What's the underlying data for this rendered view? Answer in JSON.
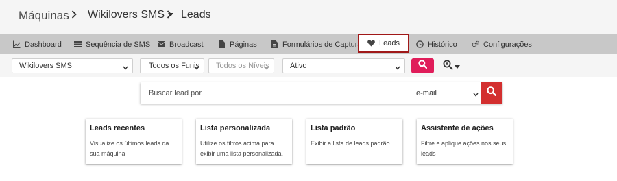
{
  "breadcrumb": {
    "root": "Máquinas",
    "machine": "Wikilovers SMS",
    "current": "Leads"
  },
  "tabs": [
    {
      "label": "Dashboard",
      "icon": "chart-line-icon"
    },
    {
      "label": "Sequência de SMS",
      "icon": "list-icon"
    },
    {
      "label": "Broadcast",
      "icon": "envelope-icon"
    },
    {
      "label": "Páginas",
      "icon": "file-icon"
    },
    {
      "label": "Formulários de Captura",
      "icon": "form-icon"
    },
    {
      "label": "Leads",
      "icon": "heart-icon",
      "active": true
    },
    {
      "label": "Histórico",
      "icon": "clock-icon"
    },
    {
      "label": "Configurações",
      "icon": "gears-icon"
    }
  ],
  "filters": {
    "machine": "Wikilovers SMS",
    "funnel": "Todos os Funis",
    "level": "Todos os Níveis",
    "status": "Ativo"
  },
  "search": {
    "placeholder": "Buscar lead por",
    "field": "e-mail"
  },
  "cards": [
    {
      "title": "Leads recentes",
      "description": "Visualize os últimos leads da sua máquina"
    },
    {
      "title": "Lista personalizada",
      "description": "Utilize os filtros acima para exibir uma lista personalizada."
    },
    {
      "title": "Lista padrão",
      "description": "Exibir a lista de leads padrão"
    },
    {
      "title": "Assistente de ações",
      "description": "Filtre e aplique ações nos seus leads"
    }
  ],
  "colors": {
    "accent_pink": "#e01d5a",
    "search_red": "#d32f2f",
    "active_tab_border": "#a01818"
  }
}
